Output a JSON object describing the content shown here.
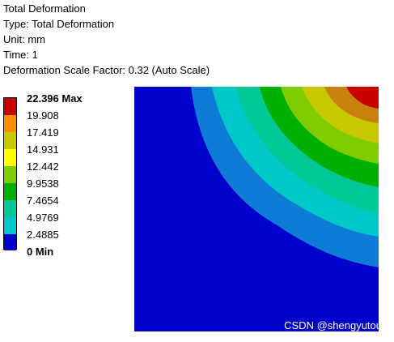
{
  "header": {
    "title": "Total Deformation",
    "type": "Type: Total Deformation",
    "unit": "Unit: mm",
    "time": "Time: 1",
    "scale_factor": "Deformation Scale Factor: 0.32 (Auto Scale)"
  },
  "legend": {
    "labels": [
      "22.396 Max",
      "19.908",
      "17.419",
      "14.931",
      "12.442",
      "9.9538",
      "7.4654",
      "4.9769",
      "2.4885",
      "0 Min"
    ],
    "colors": [
      "#c80000",
      "#ff8c00",
      "#c8c800",
      "#ffff00",
      "#7fcc00",
      "#00b000",
      "#00c896",
      "#00c8c8",
      "#1a9bff",
      "#0000cc"
    ]
  },
  "watermark": "CSDN @shengyutou"
}
